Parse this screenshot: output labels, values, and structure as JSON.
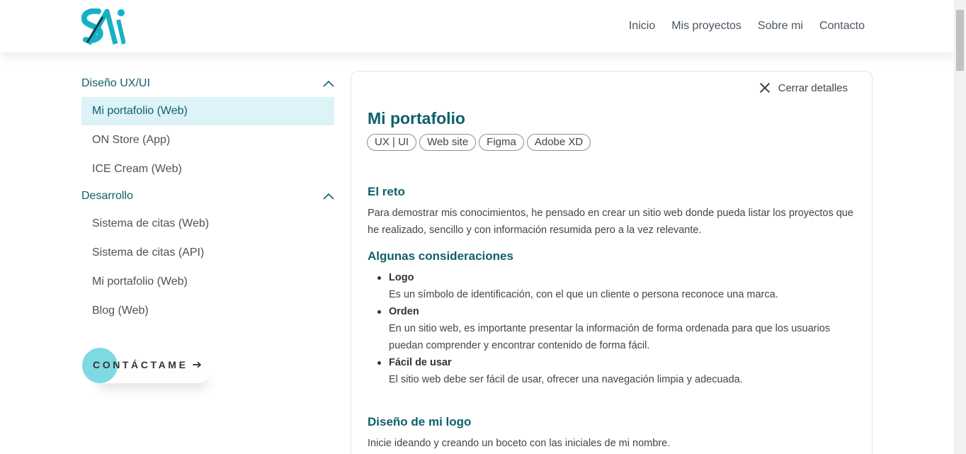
{
  "nav": {
    "items": [
      "Inicio",
      "Mis proyectos",
      "Sobre mi",
      "Contacto"
    ]
  },
  "colors": {
    "accent": "#0e5f6b",
    "brand": "#14b2c4",
    "active_bg": "#dcf3f7"
  },
  "sidebar": {
    "groups": [
      {
        "title": "Diseño UX/UI",
        "items": [
          "Mi portafolio (Web)",
          "ON Store (App)",
          "ICE Cream (Web)"
        ]
      },
      {
        "title": "Desarrollo",
        "items": [
          "Sistema de citas (Web)",
          "Sistema de citas (API)",
          "Mi portafolio (Web)",
          "Blog (Web)"
        ]
      }
    ],
    "contact_label": "CONTÁCTAME",
    "contact_arrow": "➔"
  },
  "detail": {
    "close_label": "Cerrar detalles",
    "title": "Mi portafolio",
    "tags": [
      "UX | UI",
      "Web site",
      "Figma",
      "Adobe XD"
    ],
    "challenge_title": "El reto",
    "challenge_text": "Para demostrar mis conocimientos, he pensado en crear un sitio web donde pueda listar los proyectos que he realizado, sencillo y con información resumida pero a la vez relevante.",
    "considerations_title": "Algunas consideraciones",
    "considerations": [
      {
        "title": "Logo",
        "text": "Es un símbolo de identificación, con el que un cliente o persona reconoce una marca."
      },
      {
        "title": "Orden",
        "text": "En un sitio web, es importante presentar la información de forma ordenada para que los usuarios puedan comprender y encontrar contenido de forma fácil."
      },
      {
        "title": "Fácil de usar",
        "text": "El sitio web debe ser fácil de usar, ofrecer una navegación limpia y adecuada."
      }
    ],
    "logo_title": "Diseño de mi logo",
    "logo_text": "Inicie ideando y creando un boceto con las iniciales de mi nombre."
  }
}
